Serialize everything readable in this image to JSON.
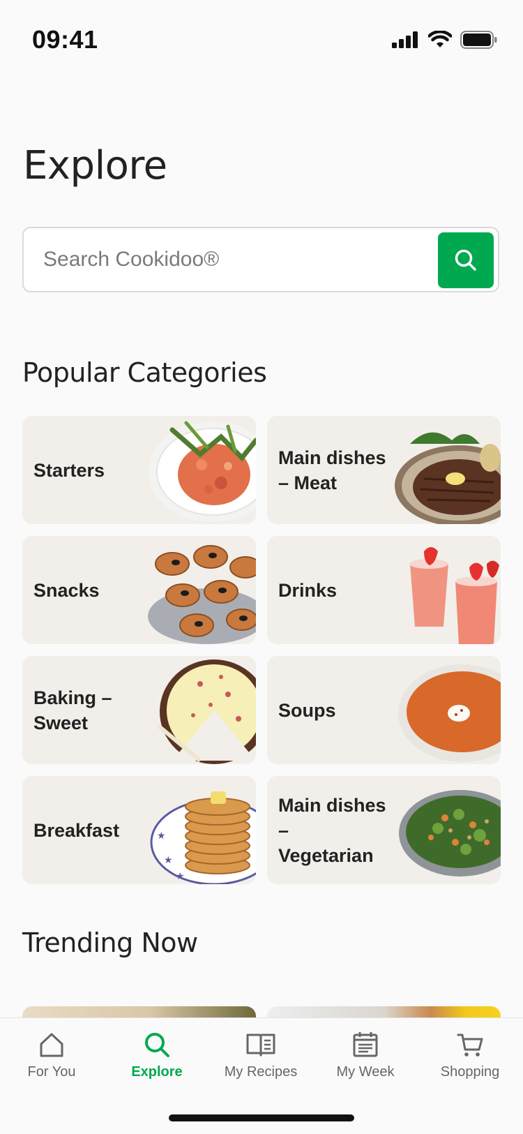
{
  "status_bar": {
    "time": "09:41"
  },
  "page": {
    "title": "Explore"
  },
  "search": {
    "placeholder": "Search Cookidoo®",
    "value": ""
  },
  "sections": {
    "popular": "Popular Categories",
    "trending": "Trending Now"
  },
  "categories": [
    {
      "label": "Starters",
      "image": "salmon-tartare-plate"
    },
    {
      "label": "Main dishes\n– Meat",
      "image": "grilled-steak-plate"
    },
    {
      "label": "Snacks",
      "image": "bruschetta-with-olives"
    },
    {
      "label": "Drinks",
      "image": "strawberry-smoothies"
    },
    {
      "label": "Baking –\nSweet",
      "image": "sliced-cheesecake"
    },
    {
      "label": "Soups",
      "image": "tomato-soup-bowl"
    },
    {
      "label": "Breakfast",
      "image": "pancake-stack"
    },
    {
      "label": "Main dishes\n–\nVegetarian",
      "image": "vegetable-salad-bowl"
    }
  ],
  "tabs": [
    {
      "label": "For You",
      "icon": "home-icon",
      "active": false
    },
    {
      "label": "Explore",
      "icon": "search-icon",
      "active": true
    },
    {
      "label": "My Recipes",
      "icon": "book-icon",
      "active": false
    },
    {
      "label": "My Week",
      "icon": "calendar-icon",
      "active": false
    },
    {
      "label": "Shopping",
      "icon": "cart-icon",
      "active": false
    }
  ],
  "colors": {
    "accent": "#00a94f",
    "card_bg": "#f2efea",
    "page_bg": "#fafafa",
    "text": "#222222"
  }
}
